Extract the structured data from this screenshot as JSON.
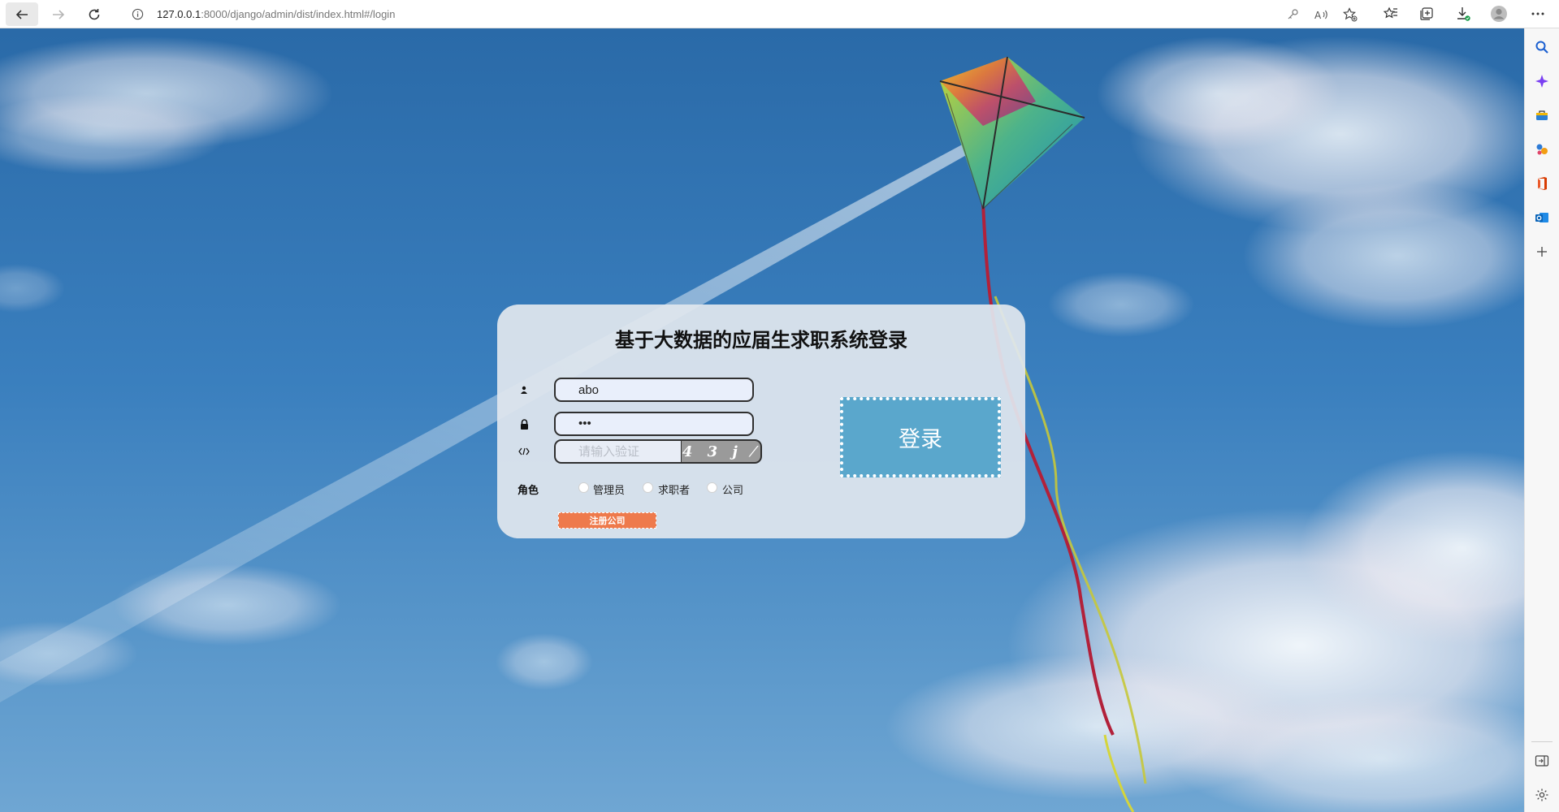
{
  "browser": {
    "url_host": "127.0.0.1",
    "url_path": ":8000/django/admin/dist/index.html#/login"
  },
  "login": {
    "title": "基于大数据的应届生求职系统登录",
    "username_value": "abo",
    "password_value": "•••",
    "captcha_placeholder": "请输入验证",
    "captcha_text": "4 3 j ⁄",
    "role_label": "角色",
    "roles": [
      "管理员",
      "求职者",
      "公司"
    ],
    "register_label": "注册公司",
    "login_label": "登录"
  },
  "colors": {
    "login_button": "#5aa7cc",
    "register_button": "#ee7a4c",
    "sky": "#2e6fae"
  }
}
